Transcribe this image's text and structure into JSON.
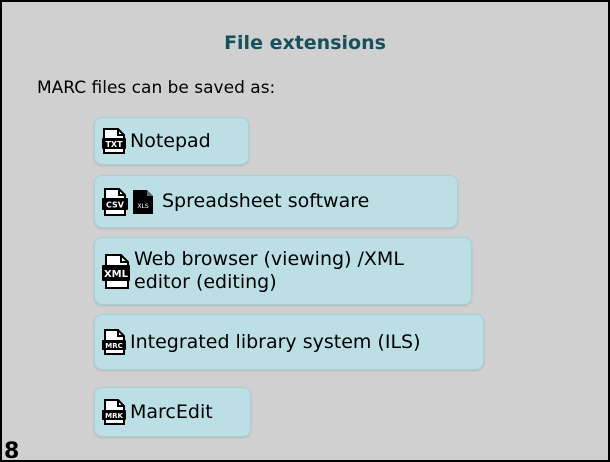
{
  "slide": {
    "title": "File extensions",
    "intro": "MARC files can be saved as:",
    "page_number": "8"
  },
  "items": [
    {
      "label": "Notepad",
      "icons": [
        {
          "name": "txt-file-icon",
          "text": "TXT"
        }
      ]
    },
    {
      "label": "Spreadsheet software",
      "icons": [
        {
          "name": "csv-file-icon",
          "text": "CSV"
        },
        {
          "name": "xls-file-icon",
          "text": "XLS"
        }
      ]
    },
    {
      "label": "Web browser (viewing) /XML editor (editing)",
      "icons": [
        {
          "name": "xml-file-icon",
          "text": "XML"
        }
      ]
    },
    {
      "label": "Integrated library system (ILS)",
      "icons": [
        {
          "name": "mrc-file-icon",
          "text": "MRC"
        }
      ]
    },
    {
      "label": "MarcEdit",
      "icons": [
        {
          "name": "mrk-file-icon",
          "text": "MRK"
        }
      ]
    }
  ],
  "colors": {
    "title": "#17505a",
    "box_fill": "#bcdfe6",
    "background": "#d0d0d0"
  }
}
